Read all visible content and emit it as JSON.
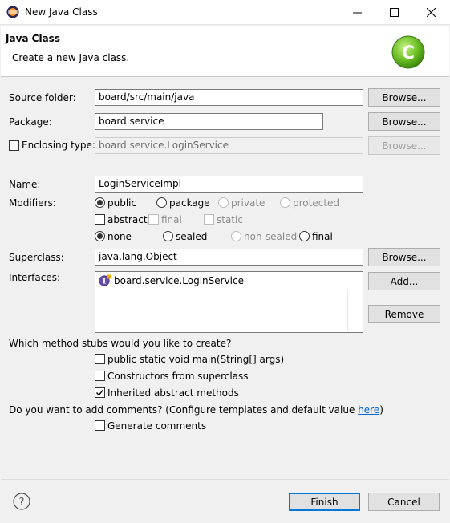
{
  "window": {
    "title": "New Java Class",
    "minimize_icon": "minimize-icon",
    "maximize_icon": "maximize-icon",
    "close_icon": "close-icon"
  },
  "banner": {
    "heading": "Java Class",
    "description": "Create a new Java class.",
    "icon": "java-class-wizard-icon",
    "icon_letter": "C"
  },
  "source_folder": {
    "label": "Source folder:",
    "value": "board/src/main/java",
    "browse": "Browse..."
  },
  "package": {
    "label": "Package:",
    "value": "board.service",
    "browse": "Browse..."
  },
  "enclosing_type": {
    "label": "Enclosing type:",
    "value": "board.service.LoginService",
    "browse": "Browse...",
    "checked": false
  },
  "name": {
    "label": "Name:",
    "value": "LoginServiceImpl"
  },
  "modifiers": {
    "label": "Modifiers:",
    "access": [
      "public",
      "package",
      "private",
      "protected"
    ],
    "access_selected": "public",
    "flags": [
      "abstract",
      "final",
      "static"
    ],
    "sealing": [
      "none",
      "sealed",
      "non-sealed",
      "final"
    ],
    "sealing_selected": "none"
  },
  "superclass": {
    "label": "Superclass:",
    "value": "java.lang.Object",
    "browse": "Browse..."
  },
  "interfaces": {
    "label": "Interfaces:",
    "items": [
      "board.service.LoginService"
    ],
    "add": "Add...",
    "remove": "Remove"
  },
  "stubs": {
    "question": "Which method stubs would you like to create?",
    "options": [
      {
        "label": "public static void main(String[] args)",
        "checked": false
      },
      {
        "label": "Constructors from superclass",
        "checked": false
      },
      {
        "label": "Inherited abstract methods",
        "checked": true
      }
    ]
  },
  "comments": {
    "question": "Do you want to add comments? (Configure templates and default value ",
    "link": "here",
    "suffix": ")",
    "generate": "Generate comments",
    "checked": false
  },
  "footer": {
    "help_icon": "help-icon",
    "finish": "Finish",
    "cancel": "Cancel"
  },
  "colors": {
    "accent": "#0078d7",
    "link": "#0066cc",
    "icon_green": "#6cc024"
  }
}
